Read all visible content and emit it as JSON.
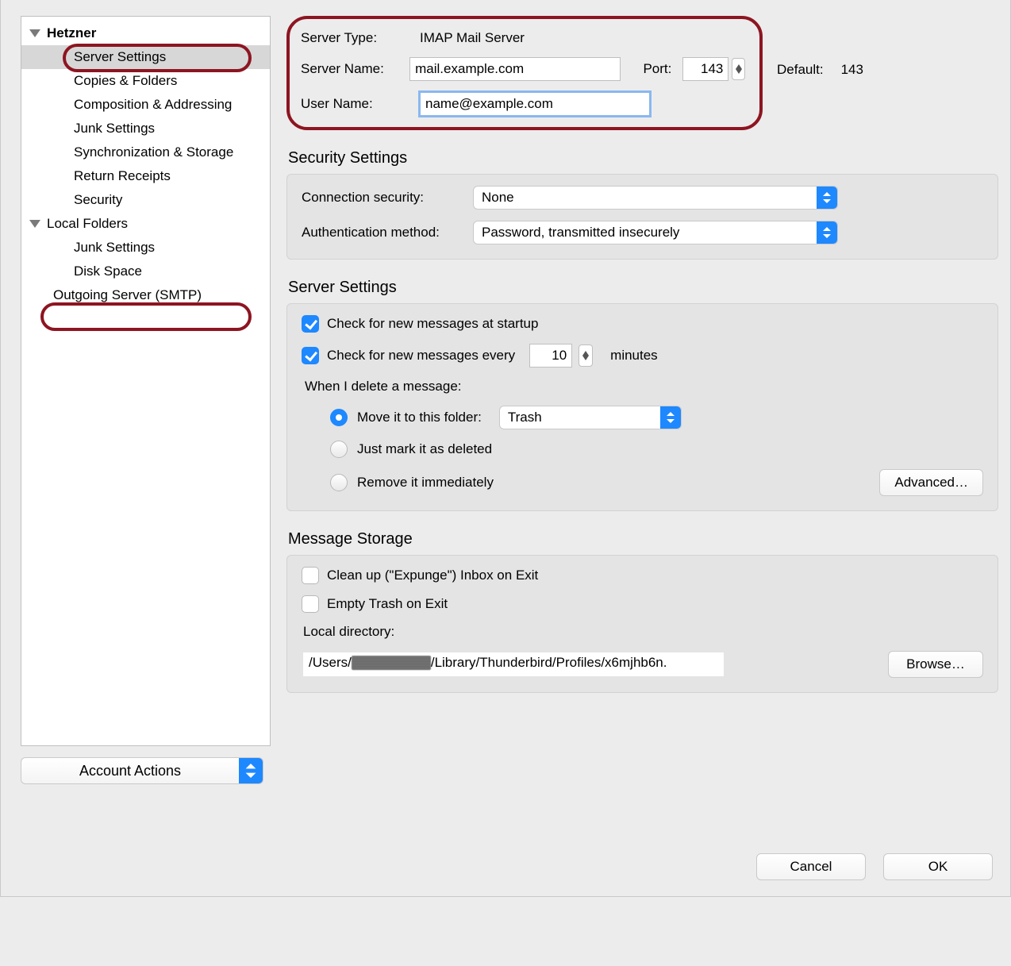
{
  "sidebar": {
    "account1": "Hetzner",
    "account1_items": [
      "Server Settings",
      "Copies & Folders",
      "Composition & Addressing",
      "Junk Settings",
      "Synchronization & Storage",
      "Return Receipts",
      "Security"
    ],
    "local_folders": "Local Folders",
    "local_items": [
      "Junk Settings",
      "Disk Space"
    ],
    "smtp": "Outgoing Server (SMTP)",
    "account_actions": "Account Actions"
  },
  "top": {
    "server_type_lbl": "Server Type:",
    "server_type_val": "IMAP Mail Server",
    "server_name_lbl": "Server Name:",
    "server_name_val": "mail.example.com",
    "port_lbl": "Port:",
    "port_val": "143",
    "default_lbl": "Default:",
    "default_val": "143",
    "user_name_lbl": "User Name:",
    "user_name_val": "name@example.com"
  },
  "security": {
    "heading": "Security Settings",
    "conn_lbl": "Connection security:",
    "conn_val": "None",
    "auth_lbl": "Authentication method:",
    "auth_val": "Password, transmitted insecurely"
  },
  "server": {
    "heading": "Server Settings",
    "check_startup": "Check for new messages at startup",
    "check_every_pre": "Check for new messages every",
    "check_every_val": "10",
    "check_every_post": "minutes",
    "when_delete": "When I delete a message:",
    "move_to": "Move it to this folder:",
    "trash": "Trash",
    "mark_deleted": "Just mark it as deleted",
    "remove_immediately": "Remove it immediately",
    "advanced": "Advanced…"
  },
  "storage": {
    "heading": "Message Storage",
    "expunge": "Clean up (\"Expunge\") Inbox on Exit",
    "empty_trash": "Empty Trash on Exit",
    "local_dir_lbl": "Local directory:",
    "local_dir_pre": "/Users/",
    "local_dir_post": "/Library/Thunderbird/Profiles/x6mjhb6n.",
    "browse": "Browse…"
  },
  "footer": {
    "cancel": "Cancel",
    "ok": "OK"
  }
}
